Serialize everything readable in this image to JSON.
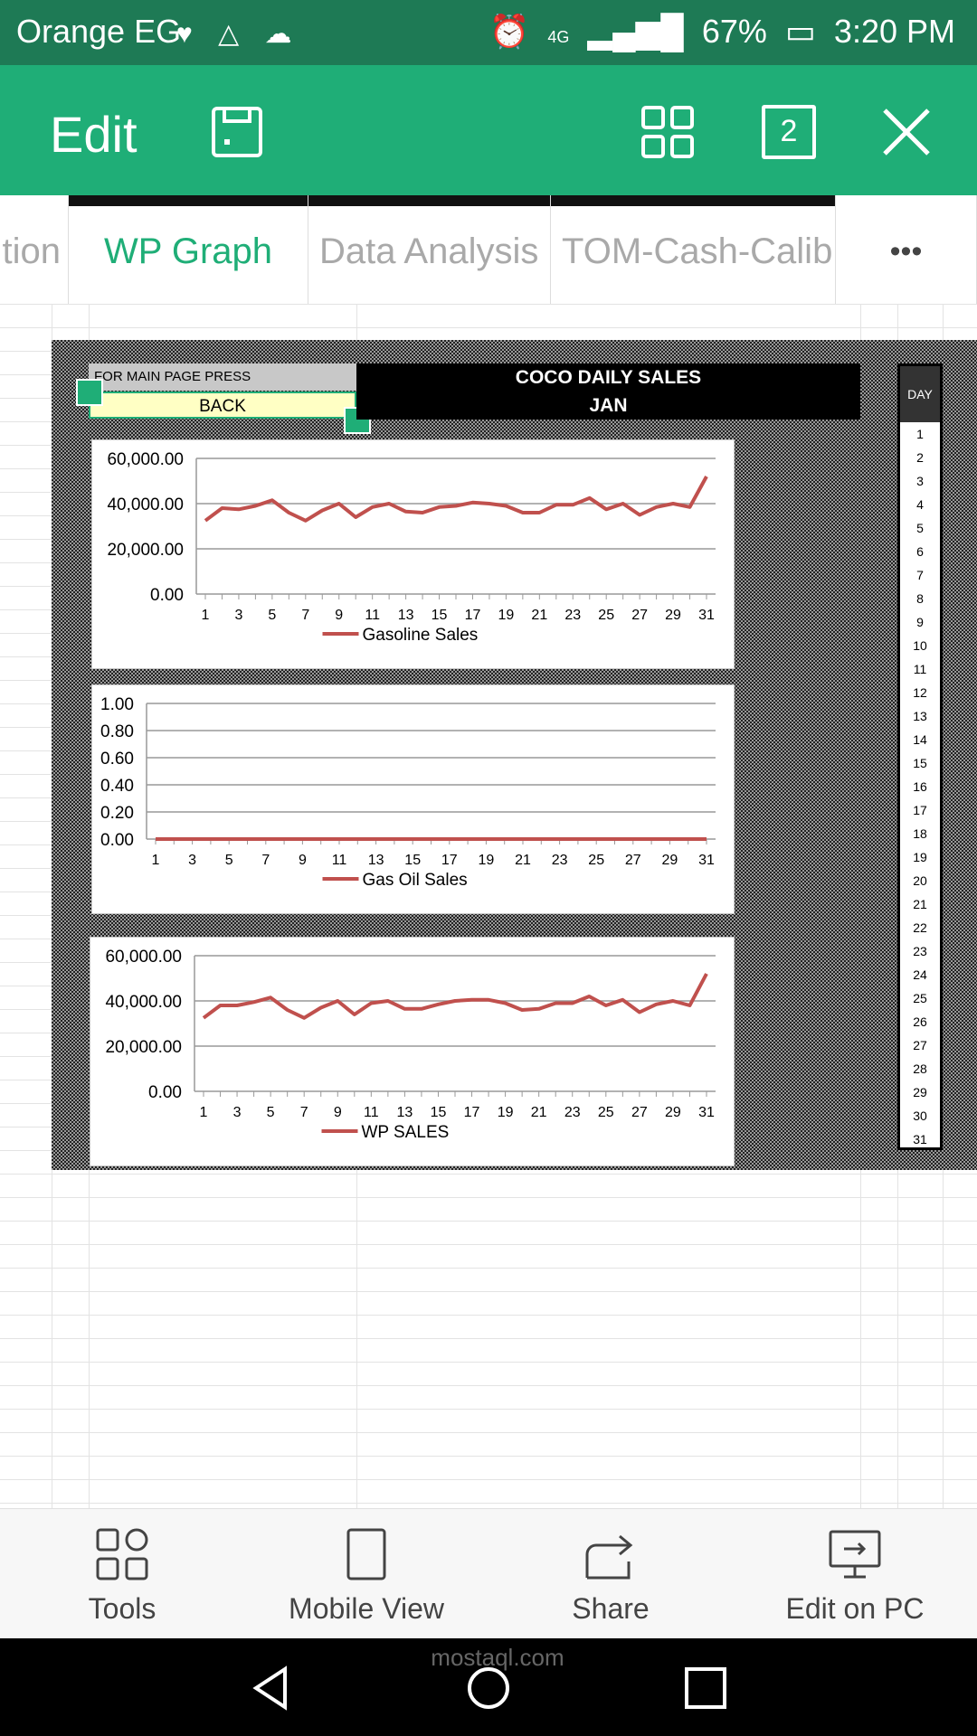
{
  "status": {
    "carrier": "Orange EG",
    "signal": "4G",
    "battery": "67%",
    "time": "3:20 PM"
  },
  "appbar": {
    "title": "Edit",
    "sheets_count": "2"
  },
  "tabs": [
    {
      "label": "tion"
    },
    {
      "label": "WP Graph"
    },
    {
      "label": "Data Analysis"
    },
    {
      "label": "TOM-Cash-Calib"
    },
    {
      "label": "•••"
    }
  ],
  "sheet": {
    "main_page_note": "FOR MAIN PAGE PRESS",
    "back_button": "BACK",
    "title_line1": "COCO DAILY SALES",
    "title_line2": "JAN",
    "day_header": "DAY",
    "days": [
      "1",
      "2",
      "3",
      "4",
      "5",
      "6",
      "7",
      "8",
      "9",
      "10",
      "11",
      "12",
      "13",
      "14",
      "15",
      "16",
      "17",
      "18",
      "19",
      "20",
      "21",
      "22",
      "23",
      "24",
      "25",
      "26",
      "27",
      "28",
      "29",
      "30",
      "31"
    ]
  },
  "chart_data": [
    {
      "type": "line",
      "series": [
        {
          "name": "Gasoline Sales",
          "values": [
            32500,
            38000,
            37500,
            39000,
            41500,
            36000,
            32500,
            37000,
            40000,
            34000,
            38500,
            40000,
            36500,
            36000,
            38500,
            39000,
            40500,
            40000,
            39000,
            36000,
            36000,
            39500,
            39500,
            42500,
            37500,
            40000,
            35000,
            38500,
            40000,
            38500,
            52000
          ]
        }
      ],
      "x": [
        1,
        2,
        3,
        4,
        5,
        6,
        7,
        8,
        9,
        10,
        11,
        12,
        13,
        14,
        15,
        16,
        17,
        18,
        19,
        20,
        21,
        22,
        23,
        24,
        25,
        26,
        27,
        28,
        29,
        30,
        31
      ],
      "x_ticks": [
        "1",
        "3",
        "5",
        "7",
        "9",
        "11",
        "13",
        "15",
        "17",
        "19",
        "21",
        "23",
        "25",
        "27",
        "29",
        "31"
      ],
      "y_ticks": [
        "0.00",
        "20,000.00",
        "40,000.00",
        "60,000.00"
      ],
      "ylim": [
        0,
        60000
      ],
      "legend": "bottom",
      "color": "#c0504d"
    },
    {
      "type": "line",
      "series": [
        {
          "name": "Gas Oil Sales",
          "values": [
            0,
            0,
            0,
            0,
            0,
            0,
            0,
            0,
            0,
            0,
            0,
            0,
            0,
            0,
            0,
            0,
            0,
            0,
            0,
            0,
            0,
            0,
            0,
            0,
            0,
            0,
            0,
            0,
            0,
            0,
            0
          ]
        }
      ],
      "x": [
        1,
        2,
        3,
        4,
        5,
        6,
        7,
        8,
        9,
        10,
        11,
        12,
        13,
        14,
        15,
        16,
        17,
        18,
        19,
        20,
        21,
        22,
        23,
        24,
        25,
        26,
        27,
        28,
        29,
        30,
        31
      ],
      "x_ticks": [
        "1",
        "3",
        "5",
        "7",
        "9",
        "11",
        "13",
        "15",
        "17",
        "19",
        "21",
        "23",
        "25",
        "27",
        "29",
        "31"
      ],
      "y_ticks": [
        "0.00",
        "0.20",
        "0.40",
        "0.60",
        "0.80",
        "1.00"
      ],
      "ylim": [
        0,
        1
      ],
      "legend": "bottom",
      "color": "#c0504d"
    },
    {
      "type": "line",
      "series": [
        {
          "name": "WP SALES",
          "values": [
            32500,
            38000,
            38000,
            39500,
            41500,
            36000,
            32500,
            37000,
            40000,
            34000,
            39000,
            40000,
            36500,
            36500,
            38500,
            40000,
            40500,
            40500,
            39000,
            36000,
            36500,
            39000,
            39000,
            42000,
            38000,
            40500,
            35000,
            38500,
            40000,
            38000,
            52000
          ]
        }
      ],
      "x": [
        1,
        2,
        3,
        4,
        5,
        6,
        7,
        8,
        9,
        10,
        11,
        12,
        13,
        14,
        15,
        16,
        17,
        18,
        19,
        20,
        21,
        22,
        23,
        24,
        25,
        26,
        27,
        28,
        29,
        30,
        31
      ],
      "x_ticks": [
        "1",
        "3",
        "5",
        "7",
        "9",
        "11",
        "13",
        "15",
        "17",
        "19",
        "21",
        "23",
        "25",
        "27",
        "29",
        "31"
      ],
      "y_ticks": [
        "0.00",
        "20,000.00",
        "40,000.00",
        "60,000.00"
      ],
      "ylim": [
        0,
        60000
      ],
      "legend": "bottom",
      "color": "#c0504d"
    }
  ],
  "bottombar": {
    "tools": "Tools",
    "mobile_view": "Mobile View",
    "share": "Share",
    "edit_on_pc": "Edit on PC"
  },
  "watermark": "mostaql.com",
  "colors": {
    "accent": "#1fae77",
    "status_bar": "#1e7a55",
    "series_line": "#c0504d"
  }
}
